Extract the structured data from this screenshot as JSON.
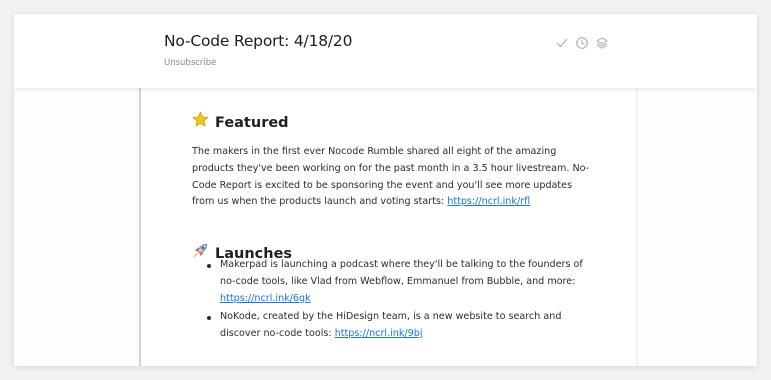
{
  "header": {
    "title": "No-Code Report: 4/18/20",
    "unsubscribe": "Unsubscribe",
    "icons": [
      "check-icon",
      "clock-icon",
      "layers-icon"
    ]
  },
  "featured": {
    "emoji": "⭐",
    "heading": "Featured",
    "text": "The makers in the first ever Nocode Rumble shared all eight of the amazing products they've been working on for the past month in a 3.5 hour livestream. No-Code Report is excited to be sponsoring the event and you'll see more updates from us when the products launch and voting starts: ",
    "link": "https://ncrl.ink/rfl"
  },
  "launches": {
    "emoji": "🚀",
    "heading": "Launches",
    "items": [
      {
        "text": "Makerpad is launching a podcast where they'll be talking to the founders of no-code tools, like Vlad from Webflow, Emmanuel from Bubble, and more: ",
        "link": "https://ncrl.ink/6gk"
      },
      {
        "text": "NoKode, created by the HiDesign team, is a new website to search and discover no-code tools: ",
        "link": "https://ncrl.ink/9bj"
      }
    ]
  },
  "colors": {
    "link": "#1a73e8",
    "star": "#f5c518",
    "accent_border": "#cfd4e3"
  }
}
